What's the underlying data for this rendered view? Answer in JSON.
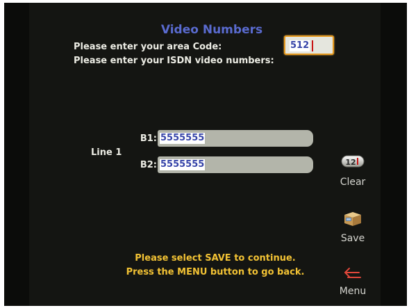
{
  "screen": {
    "title": "Video Numbers",
    "area_code_prompt": "Please enter your area Code:",
    "isdn_prompt": "Please enter your ISDN video numbers:"
  },
  "area_code": {
    "value": "512",
    "state": "focused"
  },
  "lines": [
    {
      "label": "Line 1",
      "channels": [
        {
          "label": "B1:",
          "value": "5555555"
        },
        {
          "label": "B2:",
          "value": "5555555"
        }
      ]
    }
  ],
  "side_menu": {
    "clear": {
      "label": "Clear",
      "icon": "keypad-12-icon",
      "icon_text": "12"
    },
    "save": {
      "label": "Save",
      "icon": "save-box-icon"
    },
    "menu": {
      "label": "Menu",
      "icon": "back-arrow-icon"
    }
  },
  "footer": {
    "line1": "Please select SAVE to continue.",
    "line2": "Press the MENU button to go back."
  },
  "colors": {
    "background": "#141512",
    "title": "#5a6bd0",
    "prompt_text": "#ecece4",
    "footer_text": "#f2c234",
    "focus_border": "#e79a1e",
    "field_background": "#b3b5aa",
    "value_text": "#3543a8",
    "menu_arrow": "#e0473a"
  }
}
